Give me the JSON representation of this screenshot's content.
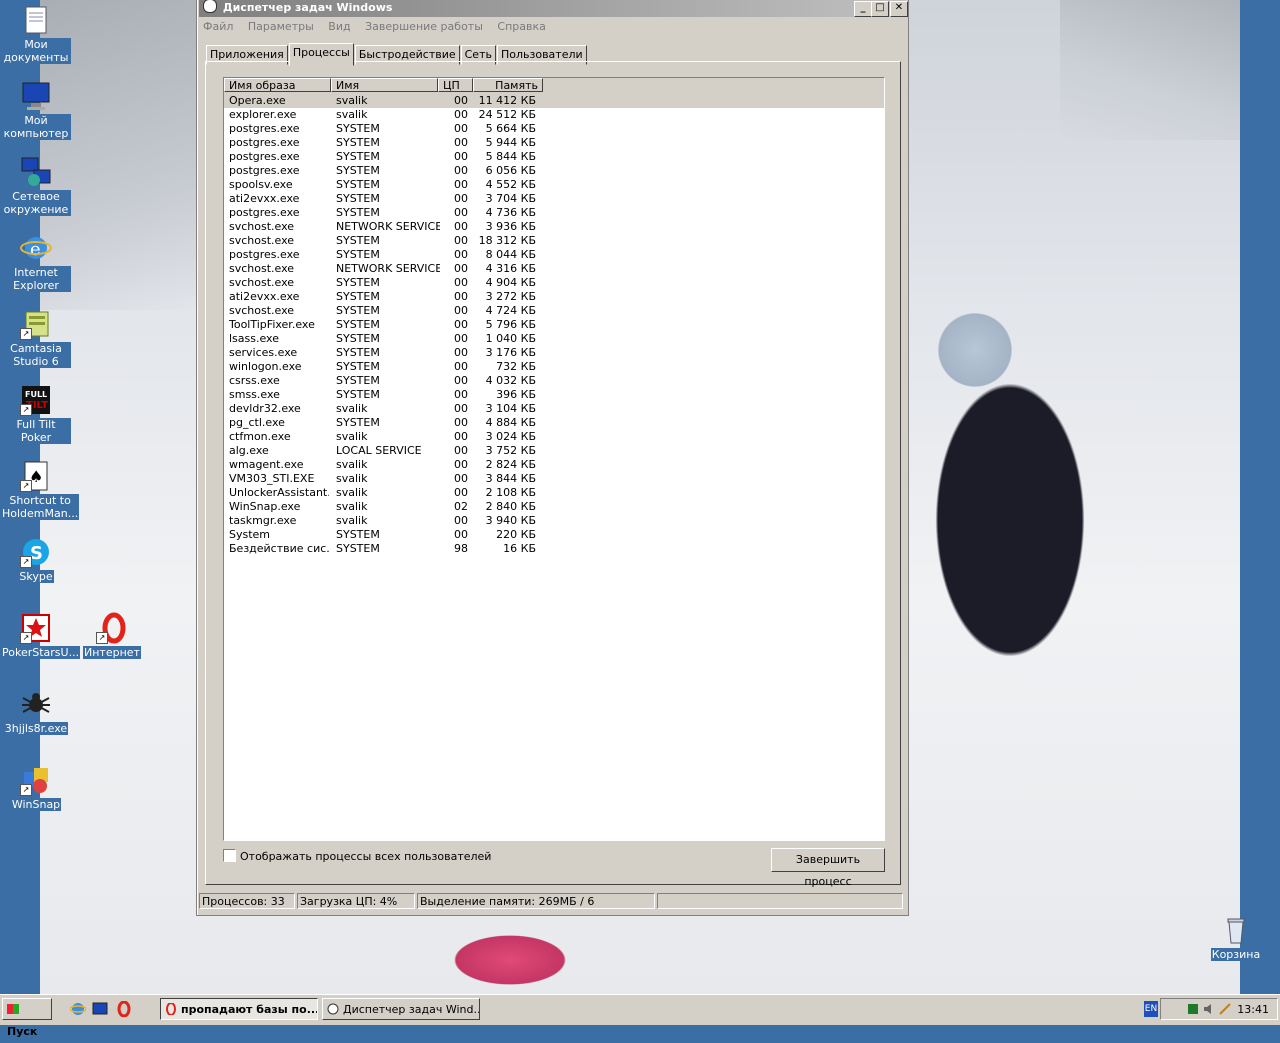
{
  "desktop": {
    "icons": [
      {
        "label": "Мои документы"
      },
      {
        "label": "Мой компьютер"
      },
      {
        "label": "Сетевое окружение"
      },
      {
        "label": "Internet Explorer"
      },
      {
        "label": "Camtasia Studio 6"
      },
      {
        "label": "Full Tilt Poker"
      },
      {
        "label": "Shortcut to HoldemMan..."
      },
      {
        "label": "Skype"
      },
      {
        "label": "PokerStarsU..."
      },
      {
        "label": "Интернет"
      },
      {
        "label": "3hjjls8r.exe"
      },
      {
        "label": "WinSnap"
      },
      {
        "label": "Корзина"
      }
    ]
  },
  "taskmgr": {
    "title": "Диспетчер задач Windows",
    "menu": [
      "Файл",
      "Параметры",
      "Вид",
      "Завершение работы",
      "Справка"
    ],
    "tabs": [
      "Приложения",
      "Процессы",
      "Быстродействие",
      "Сеть",
      "Пользователи"
    ],
    "columns": [
      "Имя образа",
      "Имя пользователя",
      "ЦП",
      "Память"
    ],
    "rows": [
      [
        "Opera.exe",
        "svalik",
        "00",
        "11 412 КБ"
      ],
      [
        "explorer.exe",
        "svalik",
        "00",
        "24 512 КБ"
      ],
      [
        "postgres.exe",
        "SYSTEM",
        "00",
        "5 664 КБ"
      ],
      [
        "postgres.exe",
        "SYSTEM",
        "00",
        "5 944 КБ"
      ],
      [
        "postgres.exe",
        "SYSTEM",
        "00",
        "5 844 КБ"
      ],
      [
        "postgres.exe",
        "SYSTEM",
        "00",
        "6 056 КБ"
      ],
      [
        "spoolsv.exe",
        "SYSTEM",
        "00",
        "4 552 КБ"
      ],
      [
        "ati2evxx.exe",
        "SYSTEM",
        "00",
        "3 704 КБ"
      ],
      [
        "postgres.exe",
        "SYSTEM",
        "00",
        "4 736 КБ"
      ],
      [
        "svchost.exe",
        "NETWORK SERVICE",
        "00",
        "3 936 КБ"
      ],
      [
        "svchost.exe",
        "SYSTEM",
        "00",
        "18 312 КБ"
      ],
      [
        "postgres.exe",
        "SYSTEM",
        "00",
        "8 044 КБ"
      ],
      [
        "svchost.exe",
        "NETWORK SERVICE",
        "00",
        "4 316 КБ"
      ],
      [
        "svchost.exe",
        "SYSTEM",
        "00",
        "4 904 КБ"
      ],
      [
        "ati2evxx.exe",
        "SYSTEM",
        "00",
        "3 272 КБ"
      ],
      [
        "svchost.exe",
        "SYSTEM",
        "00",
        "4 724 КБ"
      ],
      [
        "ToolTipFixer.exe",
        "SYSTEM",
        "00",
        "5 796 КБ"
      ],
      [
        "lsass.exe",
        "SYSTEM",
        "00",
        "1 040 КБ"
      ],
      [
        "services.exe",
        "SYSTEM",
        "00",
        "3 176 КБ"
      ],
      [
        "winlogon.exe",
        "SYSTEM",
        "00",
        "732 КБ"
      ],
      [
        "csrss.exe",
        "SYSTEM",
        "00",
        "4 032 КБ"
      ],
      [
        "smss.exe",
        "SYSTEM",
        "00",
        "396 КБ"
      ],
      [
        "devldr32.exe",
        "svalik",
        "00",
        "3 104 КБ"
      ],
      [
        "pg_ctl.exe",
        "SYSTEM",
        "00",
        "4 884 КБ"
      ],
      [
        "ctfmon.exe",
        "svalik",
        "00",
        "3 024 КБ"
      ],
      [
        "alg.exe",
        "LOCAL SERVICE",
        "00",
        "3 752 КБ"
      ],
      [
        "wmagent.exe",
        "svalik",
        "00",
        "2 824 КБ"
      ],
      [
        "VM303_STI.EXE",
        "svalik",
        "00",
        "3 844 КБ"
      ],
      [
        "UnlockerAssistant...",
        "svalik",
        "00",
        "2 108 КБ"
      ],
      [
        "WinSnap.exe",
        "svalik",
        "02",
        "2 840 КБ"
      ],
      [
        "taskmgr.exe",
        "svalik",
        "00",
        "3 940 КБ"
      ],
      [
        "System",
        "SYSTEM",
        "00",
        "220 КБ"
      ],
      [
        "Бездействие сис...",
        "SYSTEM",
        "98",
        "16 КБ"
      ]
    ],
    "show_all_label": "Отображать процессы всех пользователей",
    "end_process_label": "Завершить процесс",
    "status": {
      "processes": "Процессов: 33",
      "cpu": "Загрузка ЦП: 4%",
      "memory": "Выделение памяти: 269МБ / 6"
    }
  },
  "taskbar": {
    "start_label": "Пуск",
    "tasks": [
      {
        "label": "пропадают базы по..."
      },
      {
        "label": "Диспетчер задач Wind..."
      }
    ],
    "lang": "EN",
    "clock": "13:41"
  }
}
